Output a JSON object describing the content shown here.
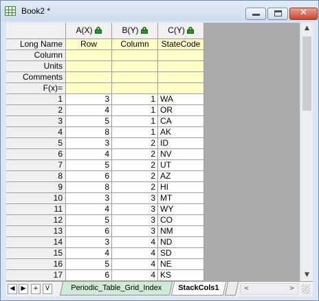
{
  "window": {
    "title": "Book2 *",
    "minimize_glyph": "",
    "close_glyph": "✕"
  },
  "columns": [
    {
      "header": "A(X)",
      "long_name": "Row"
    },
    {
      "header": "B(Y)",
      "long_name": "Column"
    },
    {
      "header": "C(Y)",
      "long_name": "StateCode"
    }
  ],
  "label_rows": [
    "Long Name",
    "Column",
    "Units",
    "Comments",
    "F(x)="
  ],
  "rows": [
    {
      "n": "1",
      "a": "3",
      "b": "1",
      "c": "WA"
    },
    {
      "n": "2",
      "a": "4",
      "b": "1",
      "c": "OR"
    },
    {
      "n": "3",
      "a": "5",
      "b": "1",
      "c": "CA"
    },
    {
      "n": "4",
      "a": "8",
      "b": "1",
      "c": "AK"
    },
    {
      "n": "5",
      "a": "3",
      "b": "2",
      "c": "ID"
    },
    {
      "n": "6",
      "a": "4",
      "b": "2",
      "c": "NV"
    },
    {
      "n": "7",
      "a": "5",
      "b": "2",
      "c": "UT"
    },
    {
      "n": "8",
      "a": "6",
      "b": "2",
      "c": "AZ"
    },
    {
      "n": "9",
      "a": "8",
      "b": "2",
      "c": "HI"
    },
    {
      "n": "10",
      "a": "3",
      "b": "3",
      "c": "MT"
    },
    {
      "n": "11",
      "a": "4",
      "b": "3",
      "c": "WY"
    },
    {
      "n": "12",
      "a": "5",
      "b": "3",
      "c": "CO"
    },
    {
      "n": "13",
      "a": "6",
      "b": "3",
      "c": "NM"
    },
    {
      "n": "14",
      "a": "3",
      "b": "4",
      "c": "ND"
    },
    {
      "n": "15",
      "a": "4",
      "b": "4",
      "c": "SD"
    },
    {
      "n": "16",
      "a": "5",
      "b": "4",
      "c": "NE"
    },
    {
      "n": "17",
      "a": "6",
      "b": "4",
      "c": "KS"
    }
  ],
  "tabs": {
    "nav": [
      "◀",
      "▶",
      "+",
      "V"
    ],
    "sheets": [
      "Periodic_Table_Grid_Index",
      "StackCols1"
    ],
    "active": "StackCols1"
  },
  "scroll": {
    "up": "▲",
    "down": "▼",
    "left": "<",
    "right": ">"
  },
  "colors": {
    "label_fill": "#ffffc8",
    "inactive_tab": "#cfead6",
    "lock": "#1e9a1e"
  }
}
